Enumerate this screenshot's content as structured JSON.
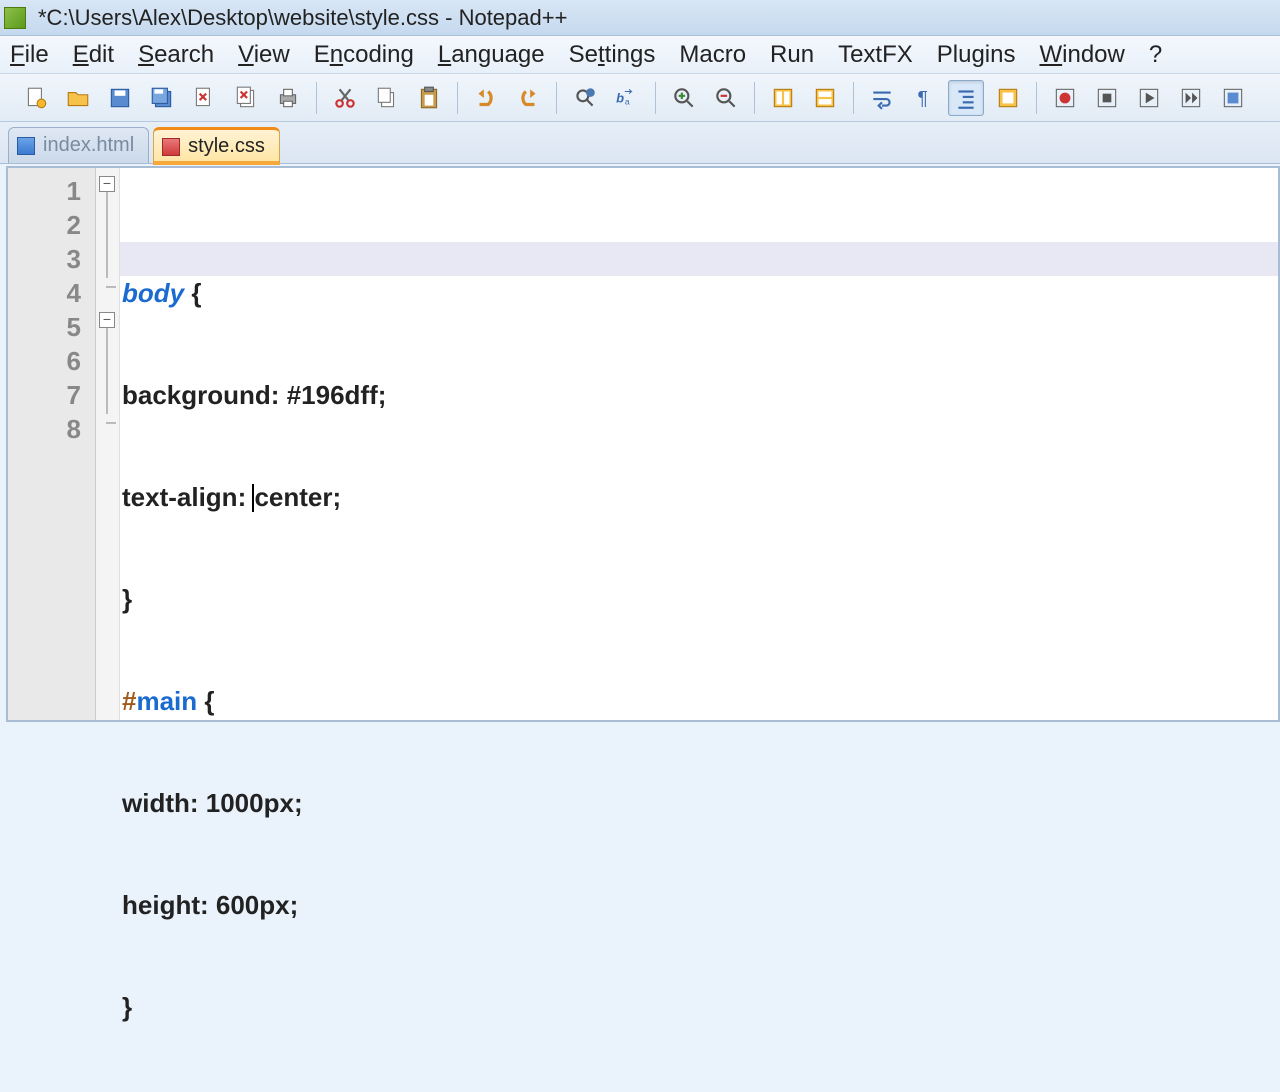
{
  "title": "*C:\\Users\\Alex\\Desktop\\website\\style.css - Notepad++",
  "menu": {
    "file": "File",
    "edit": "Edit",
    "search": "Search",
    "view": "View",
    "encoding": "Encoding",
    "language": "Language",
    "settings": "Settings",
    "macro": "Macro",
    "run": "Run",
    "textfx": "TextFX",
    "plugins": "Plugins",
    "window": "Window",
    "help": "?"
  },
  "tabs": {
    "inactive": "index.html",
    "active": "style.css"
  },
  "gutter": {
    "l1": "1",
    "l2": "2",
    "l3": "3",
    "l4": "4",
    "l5": "5",
    "l6": "6",
    "l7": "7",
    "l8": "8"
  },
  "code": {
    "l1_sel": "body",
    "l1_brace": " {",
    "l2_prop": "background",
    "l2_colon": ": ",
    "l2_val": "#196dff",
    "l2_semi": ";",
    "l3_prop": "text-align",
    "l3_colon": ": ",
    "l3_val": "center",
    "l3_semi": ";",
    "l4_brace": "}",
    "l5_hash": "#",
    "l5_sel": "main",
    "l5_brace": " {",
    "l6_prop": "width",
    "l6_colon": ": ",
    "l6_val": "1000px",
    "l6_semi": ";",
    "l7_prop": "height",
    "l7_colon": ": ",
    "l7_val": "600px",
    "l7_semi": ";",
    "l8_brace": "}"
  }
}
